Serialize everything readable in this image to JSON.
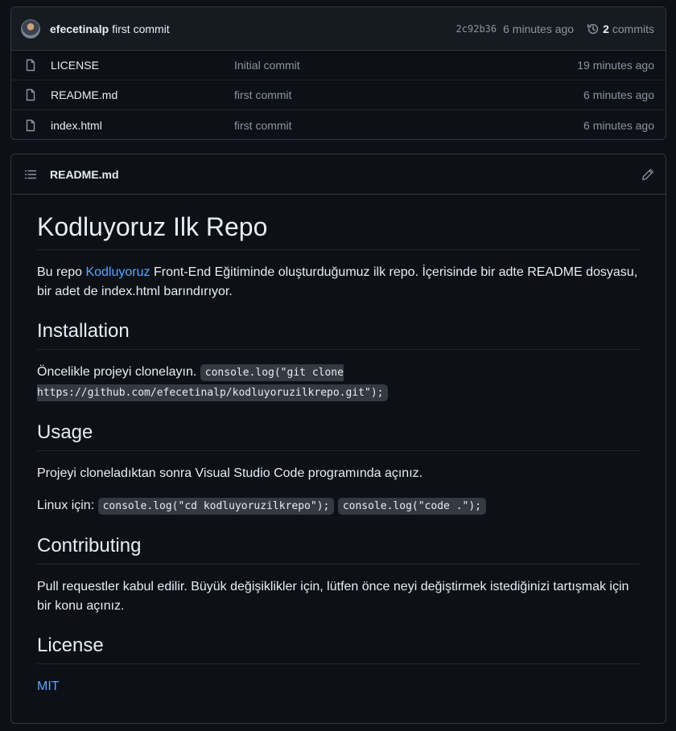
{
  "latest_commit": {
    "author": "efecetinalp",
    "message": "first commit",
    "sha": "2c92b36",
    "time": "6 minutes ago",
    "commit_count": "2",
    "commits_label": "commits"
  },
  "files": [
    {
      "name": "LICENSE",
      "commit": "Initial commit",
      "time": "19 minutes ago"
    },
    {
      "name": "README.md",
      "commit": "first commit",
      "time": "6 minutes ago"
    },
    {
      "name": "index.html",
      "commit": "first commit",
      "time": "6 minutes ago"
    }
  ],
  "readme": {
    "filename": "README.md",
    "title": "Kodluyoruz Ilk Repo",
    "intro_before": "Bu repo ",
    "intro_link": "Kodluyoruz",
    "intro_after": " Front-End Eğitiminde oluşturduğumuz ilk repo. İçerisinde bir adte README dosyasu, bir adet de index.html barındırıyor.",
    "installation_heading": "Installation",
    "installation_text": "Öncelikle projeyi clonelayın. ",
    "installation_code": "console.log(\"git clone https://github.com/efecetinalp/kodluyoruzilkrepo.git\");",
    "usage_heading": "Usage",
    "usage_text": "Projeyi cloneladıktan sonra Visual Studio Code programında açınız.",
    "usage_linux_label": "Linux için: ",
    "usage_code_1": "console.log(\"cd kodluyoruzilkrepo\");",
    "usage_code_2": "console.log(\"code .\");",
    "contributing_heading": "Contributing",
    "contributing_text": "Pull requestler kabul edilir. Büyük değişiklikler için, lütfen önce neyi değiştirmek istediğinizi tartışmak için bir konu açınız.",
    "license_heading": "License",
    "license_link": "MIT"
  },
  "icons": {
    "history": "history-icon",
    "file": "file-icon",
    "list": "list-unordered-icon",
    "edit": "pencil-icon"
  }
}
